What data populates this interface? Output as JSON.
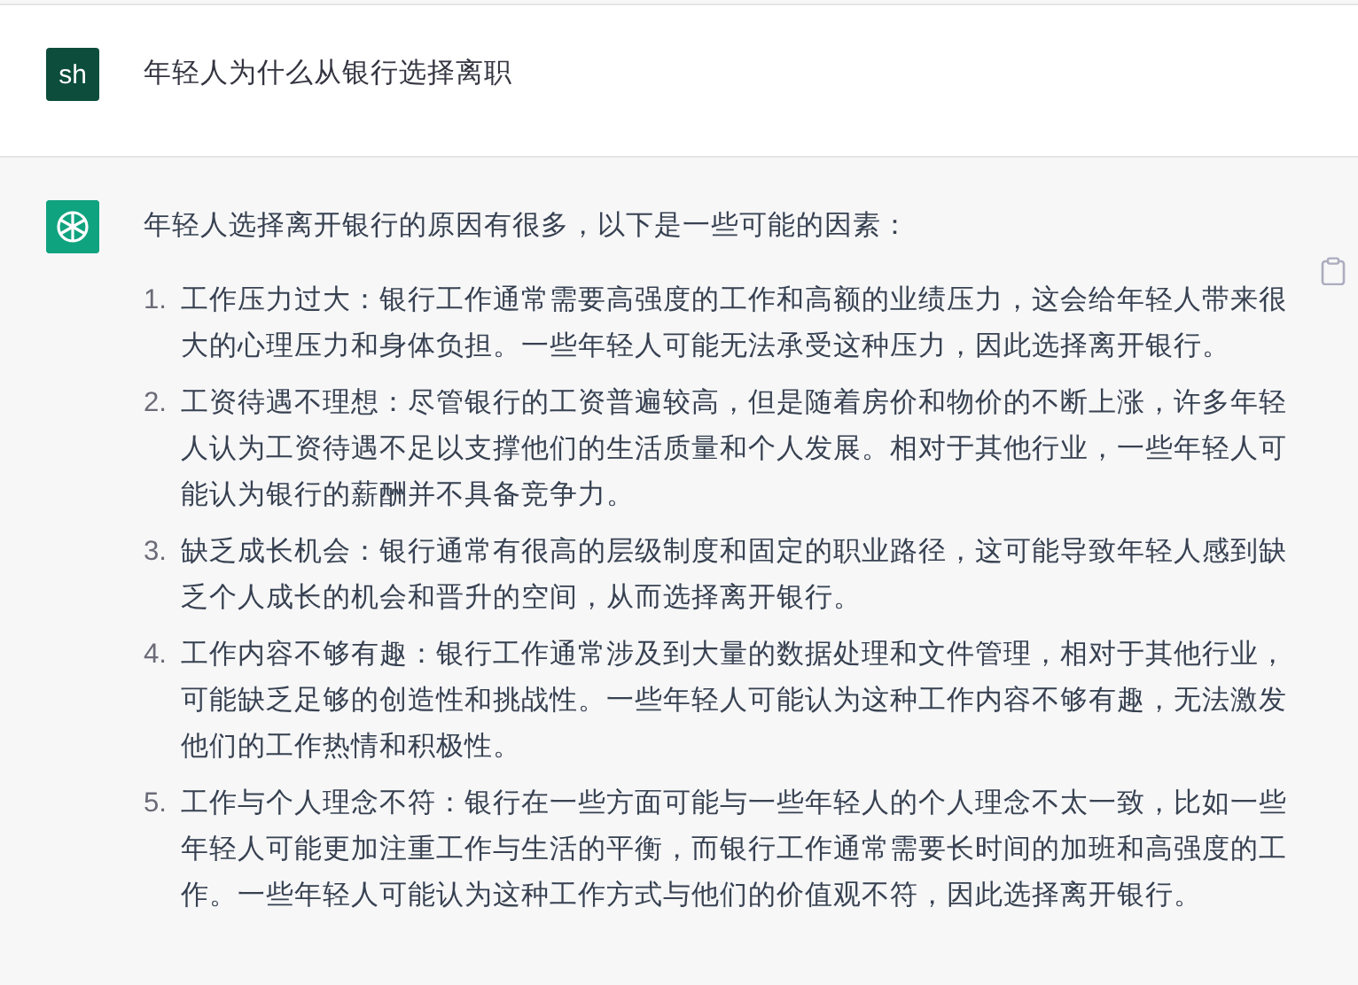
{
  "messages": [
    {
      "kind": "user",
      "avatar": "sh",
      "text": "年轻人为什么从银行选择离职"
    },
    {
      "kind": "assistant",
      "intro": "年轻人选择离开银行的原因有很多，以下是一些可能的因素：",
      "items": [
        {
          "number": "1.",
          "text": "工作压力过大：银行工作通常需要高强度的工作和高额的业绩压力，这会给年轻人带来很大的心理压力和身体负担。一些年轻人可能无法承受这种压力，因此选择离开银行。"
        },
        {
          "number": "2.",
          "text": "工资待遇不理想：尽管银行的工资普遍较高，但是随着房价和物价的不断上涨，许多年轻人认为工资待遇不足以支撑他们的生活质量和个人发展。相对于其他行业，一些年轻人可能认为银行的薪酬并不具备竞争力。"
        },
        {
          "number": "3.",
          "text": "缺乏成长机会：银行通常有很高的层级制度和固定的职业路径，这可能导致年轻人感到缺乏个人成长的机会和晋升的空间，从而选择离开银行。"
        },
        {
          "number": "4.",
          "text": "工作内容不够有趣：银行工作通常涉及到大量的数据处理和文件管理，相对于其他行业，可能缺乏足够的创造性和挑战性。一些年轻人可能认为这种工作内容不够有趣，无法激发他们的工作热情和积极性。"
        },
        {
          "number": "5.",
          "text": "工作与个人理念不符：银行在一些方面可能与一些年轻人的个人理念不太一致，比如一些年轻人可能更加注重工作与生活的平衡，而银行工作通常需要长时间的加班和高强度的工作。一些年轻人可能认为这种工作方式与他们的价值观不符，因此选择离开银行。"
        }
      ]
    }
  ]
}
